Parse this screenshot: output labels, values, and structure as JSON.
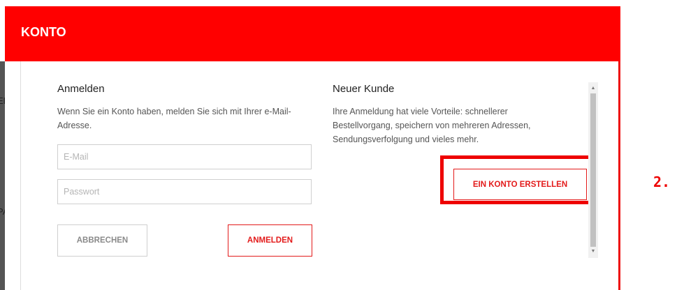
{
  "backdrop": {
    "text_top": "EB",
    "text_bottom": "PAK"
  },
  "modal": {
    "title": "KONTO"
  },
  "login": {
    "heading": "Anmelden",
    "description_line1": "Wenn Sie ein Konto haben, melden Sie sich mit Ihrer e-Mail-",
    "description_line2": "Adresse.",
    "email_placeholder": "E-Mail",
    "password_placeholder": "Passwort",
    "cancel_label": "ABBRECHEN",
    "submit_label": "ANMELDEN"
  },
  "new_customer": {
    "heading": "Neuer Kunde",
    "description_line1": "Ihre Anmeldung hat viele Vorteile: schnellerer",
    "description_line2": "Bestellvorgang, speichern von mehreren Adressen,",
    "description_line3": "Sendungsverfolgung und vieles mehr.",
    "create_label": "EIN KONTO ERSTELLEN"
  },
  "annotation": {
    "step": "2."
  },
  "colors": {
    "accent": "#ff0000",
    "highlight": "#ee0000"
  }
}
